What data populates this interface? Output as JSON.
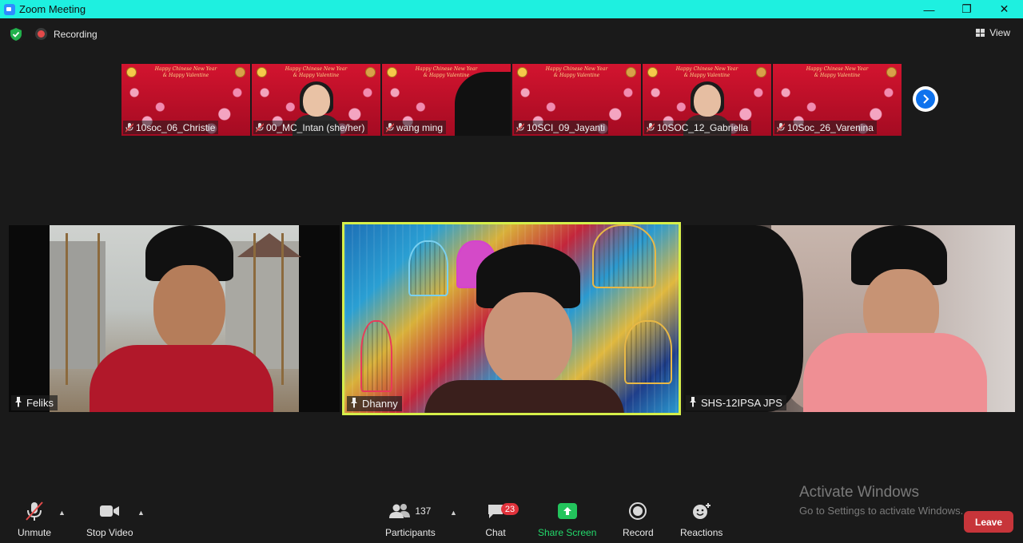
{
  "window": {
    "title": "Zoom Meeting",
    "minimize": "—",
    "maximize": "❐",
    "close": "✕"
  },
  "status": {
    "recording_label": "Recording",
    "view_label": "View"
  },
  "thumbnails": [
    {
      "name": "10soc_06_Christie"
    },
    {
      "name": "00_MC_Intan (she/her)"
    },
    {
      "name": "wang ming"
    },
    {
      "name": "10SCI_09_Jayanti"
    },
    {
      "name": "10SOC_12_Gabriella"
    },
    {
      "name": "10Soc_26_Varenina"
    }
  ],
  "thumb_banner": "Happy Chinese New Year & Happy Valentine",
  "gallery": [
    {
      "name": "Feliks"
    },
    {
      "name": "Dhanny",
      "active_speaker": true
    },
    {
      "name": "SHS-12IPSA JPS"
    }
  ],
  "toolbar": {
    "unmute": "Unmute",
    "stop_video": "Stop Video",
    "participants": "Participants",
    "participants_count": "137",
    "chat": "Chat",
    "chat_badge": "23",
    "share_screen": "Share Screen",
    "record": "Record",
    "reactions": "Reactions",
    "leave": "Leave"
  },
  "watermark": {
    "line1": "Activate Windows",
    "line2": "Go to Settings to activate Windows."
  },
  "colors": {
    "titlebar": "#1ef0e0",
    "active_speaker_border": "#d6ef4a",
    "share_green": "#23c45c",
    "leave_red": "#c7353a"
  }
}
